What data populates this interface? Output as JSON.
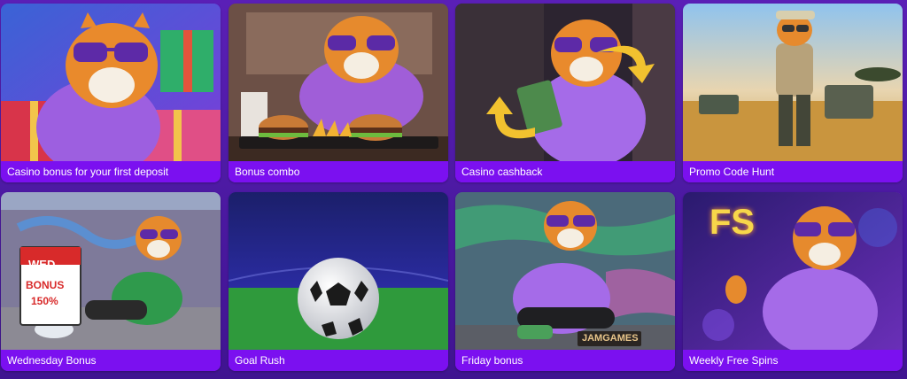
{
  "colors": {
    "card_footer": "#7b10f0",
    "page_background": "#4d1ba6",
    "title_text": "#ffffff",
    "hoodie": "#a56be8"
  },
  "promos": [
    {
      "title": "Casino bonus for your first deposit",
      "scene": "gift-boxes"
    },
    {
      "title": "Bonus combo",
      "scene": "burger-meal"
    },
    {
      "title": "Casino cashback",
      "scene": "cash-with-arrows"
    },
    {
      "title": "Promo Code Hunt",
      "scene": "safari-explorer"
    },
    {
      "title": "Wednesday Bonus",
      "scene": "calendar-street",
      "calendar": {
        "day": "WED",
        "line1": "BONUS",
        "line2": "150%"
      }
    },
    {
      "title": "Goal Rush",
      "scene": "soccer-ball"
    },
    {
      "title": "Friday bonus",
      "scene": "graffiti-wall",
      "sign": "JAMGAMES"
    },
    {
      "title": "Weekly Free Spins",
      "scene": "neon-fs",
      "neon": "FS"
    }
  ]
}
